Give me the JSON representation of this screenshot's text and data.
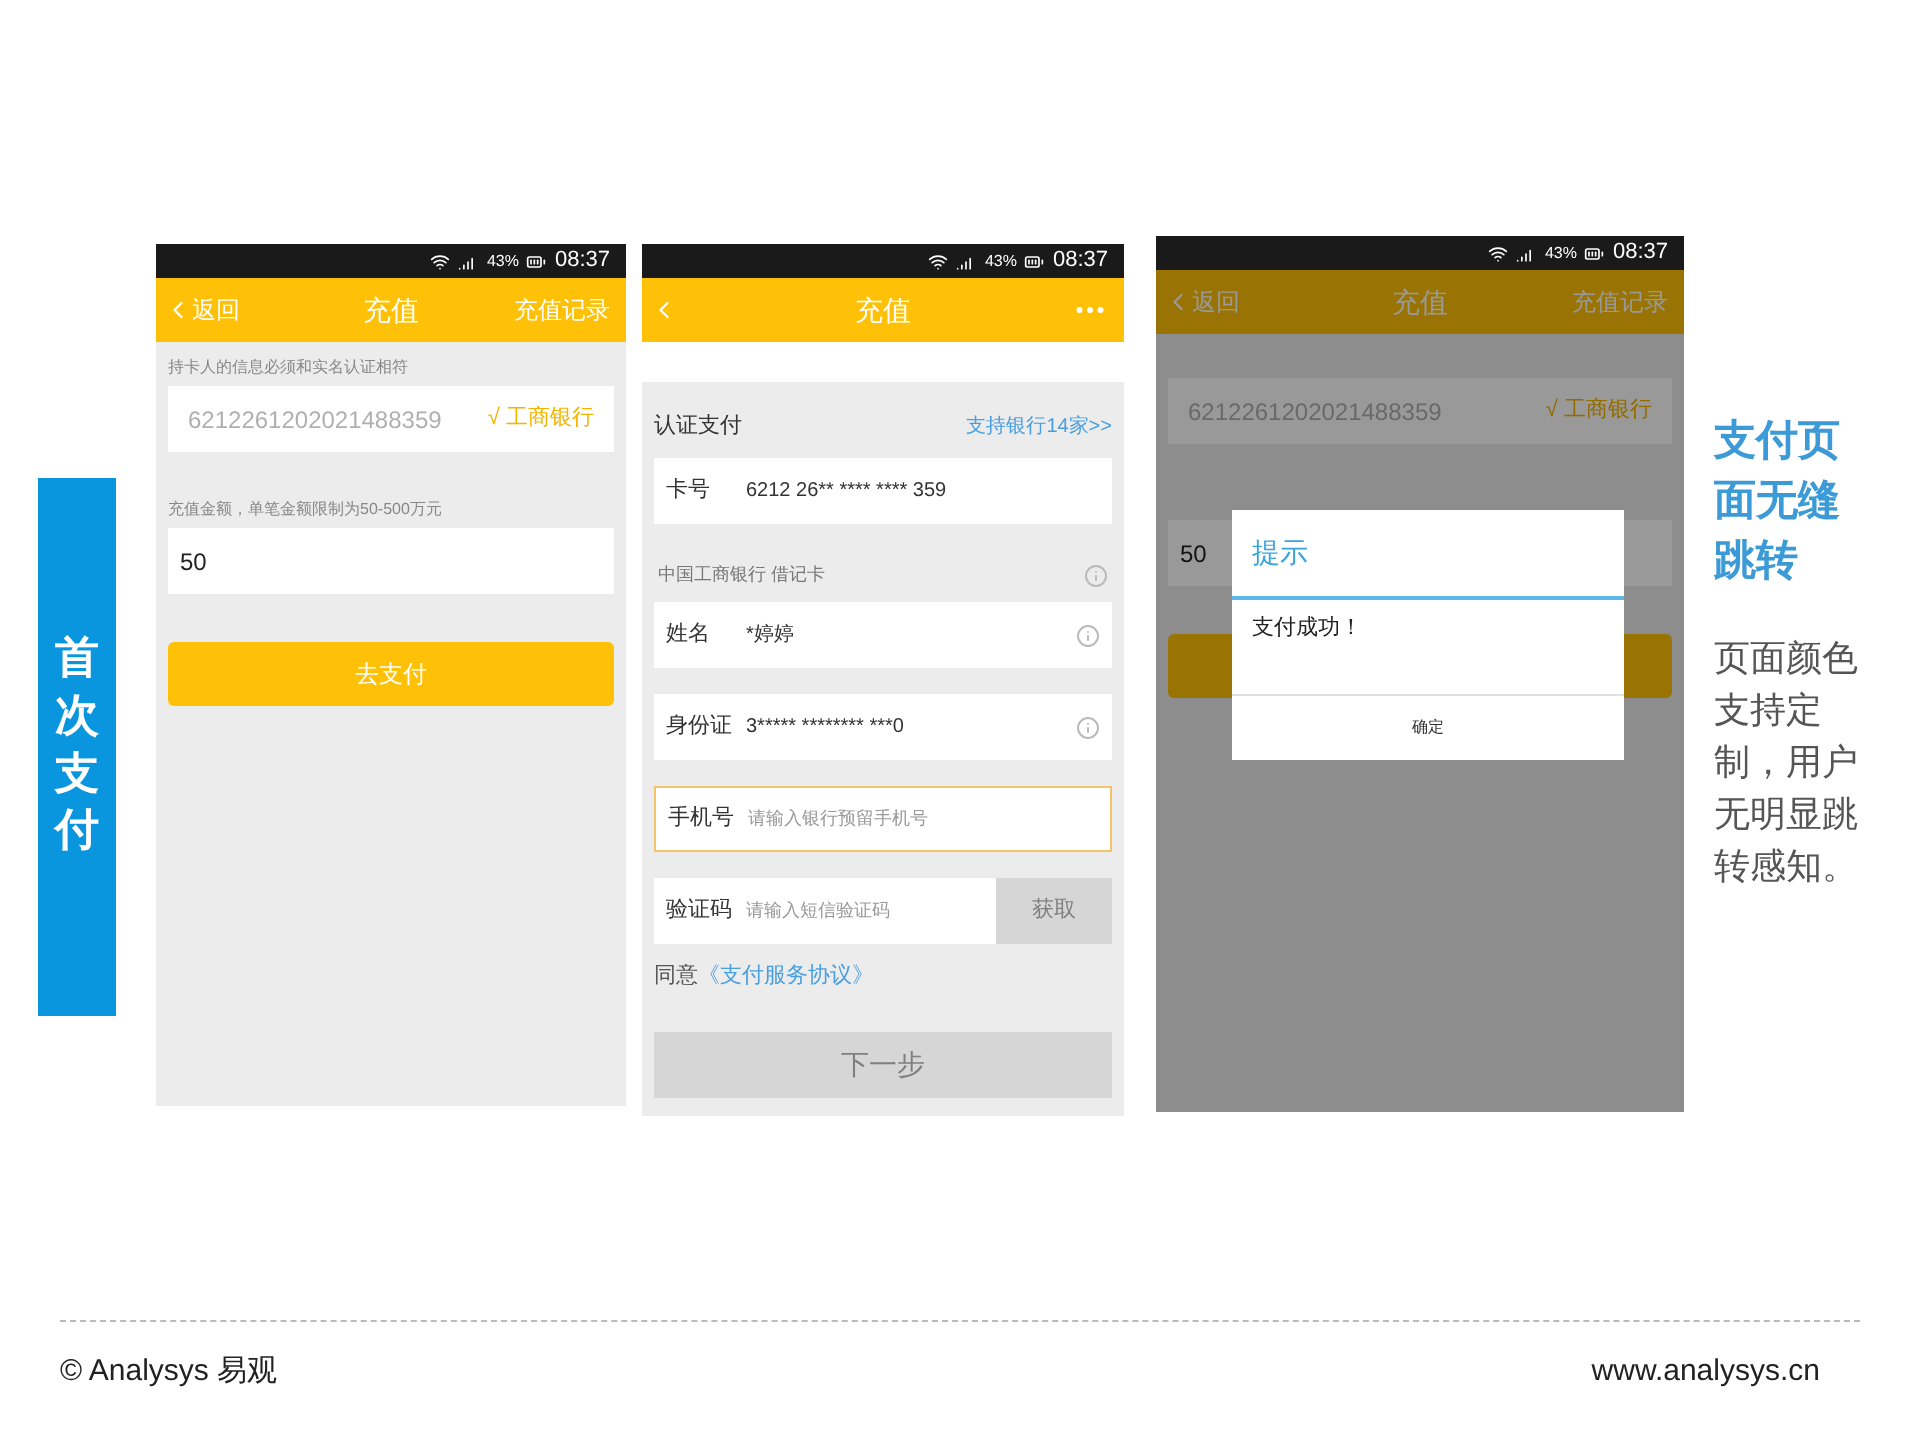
{
  "side_label": "首次支付",
  "screens": [
    {
      "kind": "recharge",
      "status": {
        "battery": "43%",
        "time": "08:37"
      },
      "nav": {
        "back": "返回",
        "title": "充值",
        "action": "充值记录"
      },
      "card_hint": "持卡人的信息必须和实名认证相符",
      "card_number": "6212261202021488359",
      "bank": "√ 工商银行",
      "amount_hint": "充值金额，单笔金额限制为50-500万元",
      "amount": "50",
      "button": "去支付"
    },
    {
      "kind": "verify",
      "status": {
        "battery": "43%",
        "time": "08:37"
      },
      "nav": {
        "title": "充值"
      },
      "section_title": "认证支付",
      "banks_link": "支持银行14家>>",
      "fields": [
        {
          "kind": "value",
          "label": "卡号",
          "value": "6212 26**  ****  **** 359",
          "info": false
        },
        {
          "kind": "note",
          "text": "中国工商银行  借记卡",
          "info": true
        },
        {
          "kind": "value",
          "label": "姓名",
          "value": "*婷婷",
          "info": true
        },
        {
          "kind": "value",
          "label": "身份证",
          "value": "3***** ******** ***0",
          "info": true
        },
        {
          "kind": "input",
          "label": "手机号",
          "placeholder": "请输入银行预留手机号",
          "focused": true
        },
        {
          "kind": "code",
          "label": "验证码",
          "placeholder": "请输入短信验证码",
          "button": "获取",
          "disabled": true
        }
      ],
      "agree": "同意",
      "agreement_link": "《支付服务协议》",
      "next_button": {
        "label": "下一步",
        "disabled": true
      }
    },
    {
      "kind": "recharge",
      "status": {
        "battery": "43%",
        "time": "08:37"
      },
      "nav": {
        "back": "返回",
        "title": "充值",
        "action": "充值记录"
      },
      "card_number": "6212261202021488359",
      "bank": "√ 工商银行",
      "amount": "50",
      "dialog": {
        "title": "提示",
        "message": "支付成功！",
        "button": "确定"
      }
    }
  ],
  "note": {
    "title": "支付页面无缝跳转",
    "body": "页面颜色支持定制，用户无明显跳转感知。"
  },
  "footer": {
    "copyright": "© Analysys 易观",
    "url": "www.analysys.cn"
  }
}
